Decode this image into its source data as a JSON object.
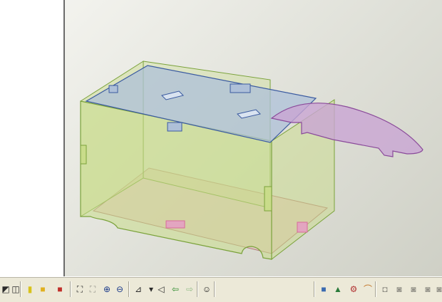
{
  "viewport": {
    "background": "#dcddd4",
    "model": "box-with-lid",
    "colors": {
      "side_panels": "#c9dc8a",
      "top_panel": "#aec0d8",
      "lid": "#c9a5d3",
      "bottom": "#e3b9b3",
      "edge_green": "#7aa23a",
      "edge_blue": "#3a5aa0",
      "edge_purple": "#8a4a9a",
      "tab_pink": "#d86a9a"
    }
  },
  "toolbar": {
    "buttons": [
      {
        "name": "view-iso-icon",
        "glyph": "◩",
        "enabled": true
      },
      {
        "name": "view-wireframe-icon",
        "glyph": "◫",
        "enabled": true
      },
      {
        "name": "shade-yellow-icon",
        "glyph": "▮",
        "enabled": true
      },
      {
        "name": "shade-box-icon",
        "glyph": "■",
        "enabled": true
      },
      {
        "name": "shade-red-icon",
        "glyph": "■",
        "enabled": true
      },
      {
        "name": "fit-view-icon",
        "glyph": "⛶",
        "enabled": true
      },
      {
        "name": "zoom-window-icon",
        "glyph": "⛶",
        "enabled": false
      },
      {
        "name": "zoom-in-icon",
        "glyph": "⊕",
        "enabled": true
      },
      {
        "name": "zoom-out-icon",
        "glyph": "⊖",
        "enabled": true
      },
      {
        "name": "view-orient-icon",
        "glyph": "⊿",
        "enabled": true
      },
      {
        "name": "dropdown-arrow-icon",
        "glyph": "▾",
        "enabled": true
      },
      {
        "name": "triangle-left-icon",
        "glyph": "◁",
        "enabled": true
      },
      {
        "name": "arrow-back-icon",
        "glyph": "⇦",
        "enabled": true
      },
      {
        "name": "arrow-forward-icon",
        "glyph": "⇨",
        "enabled": false
      },
      {
        "name": "smiley-icon",
        "glyph": "☺",
        "enabled": true
      },
      {
        "name": "part-color-icon",
        "glyph": "■",
        "enabled": true
      },
      {
        "name": "assembly-icon",
        "glyph": "▲",
        "enabled": true
      },
      {
        "name": "mechanism-icon",
        "glyph": "⚙",
        "enabled": true
      },
      {
        "name": "pipe-icon",
        "glyph": "⌒",
        "enabled": true
      },
      {
        "name": "tool-a-icon",
        "glyph": "◘",
        "enabled": false
      },
      {
        "name": "tool-b-icon",
        "glyph": "◙",
        "enabled": false
      },
      {
        "name": "tool-c-icon",
        "glyph": "◙",
        "enabled": false
      },
      {
        "name": "tool-d-icon",
        "glyph": "◙",
        "enabled": false
      },
      {
        "name": "tool-e-icon",
        "glyph": "◙",
        "enabled": false
      }
    ]
  }
}
